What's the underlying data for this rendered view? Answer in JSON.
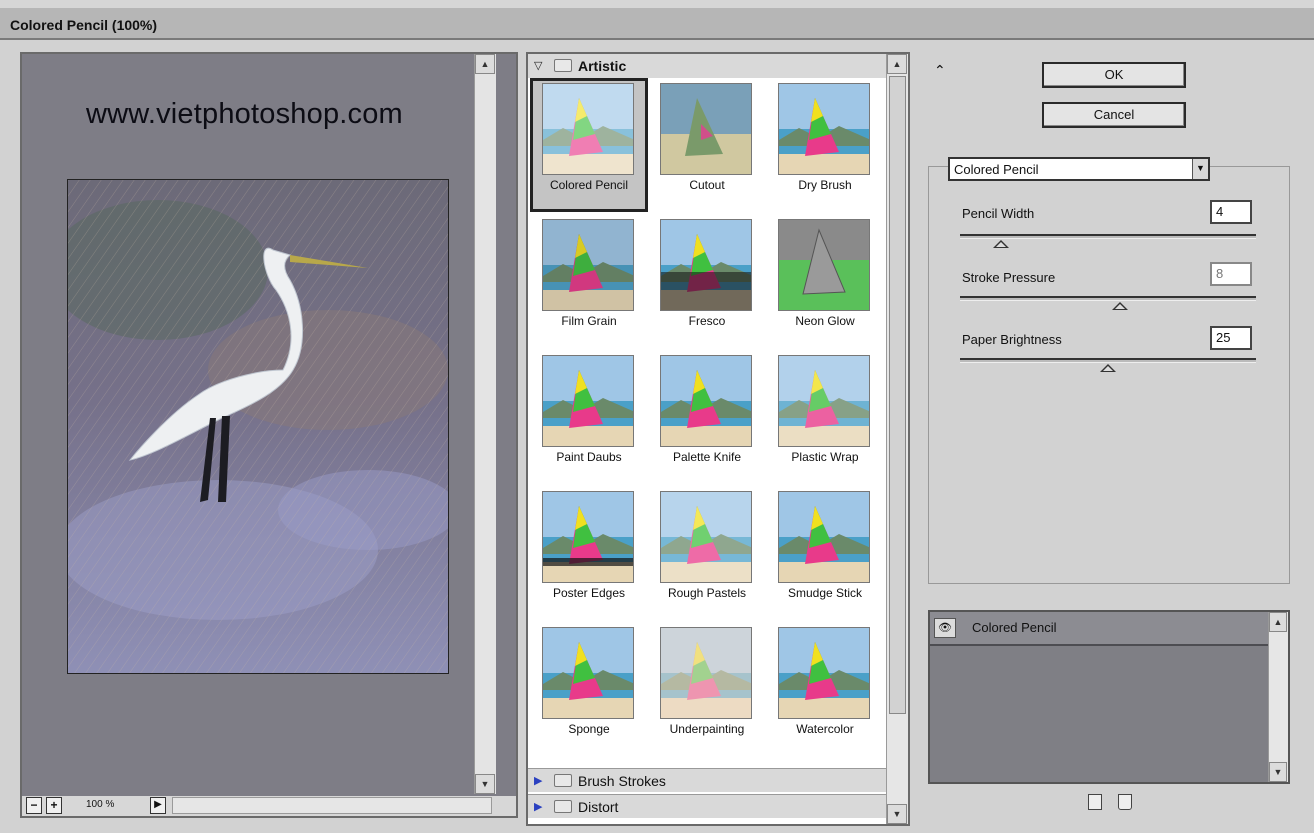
{
  "window": {
    "title": "Colored Pencil (100%)"
  },
  "preview": {
    "watermark": "www.vietphotoshop.com",
    "zoom_out_label": "−",
    "zoom_in_label": "+",
    "zoom_level": "100 %"
  },
  "gallery": {
    "categories": [
      {
        "name": "Artistic",
        "expanded": true
      },
      {
        "name": "Brush Strokes",
        "expanded": false
      },
      {
        "name": "Distort",
        "expanded": false
      }
    ],
    "filters": [
      "Colored Pencil",
      "Cutout",
      "Dry Brush",
      "Film Grain",
      "Fresco",
      "Neon Glow",
      "Paint Daubs",
      "Palette Knife",
      "Plastic Wrap",
      "Poster Edges",
      "Rough Pastels",
      "Smudge Stick",
      "Sponge",
      "Underpainting",
      "Watercolor"
    ],
    "selected_filter": "Colored Pencil"
  },
  "actions": {
    "ok_label": "OK",
    "cancel_label": "Cancel"
  },
  "settings": {
    "filter_select": "Colored Pencil",
    "params": [
      {
        "label": "Pencil Width",
        "value": "4",
        "slider_fraction": 0.14
      },
      {
        "label": "Stroke Pressure",
        "value": "8",
        "slider_fraction": 0.54
      },
      {
        "label": "Paper Brightness",
        "value": "25",
        "slider_fraction": 0.5
      }
    ]
  },
  "layers": [
    {
      "name": "Colored Pencil",
      "visible": true
    }
  ],
  "icons": {
    "collapse": "double-chevron-up-icon",
    "eye": "eye-icon",
    "new_layer": "new-effect-layer-icon",
    "delete_layer": "trash-icon",
    "folder": "folder-icon"
  }
}
